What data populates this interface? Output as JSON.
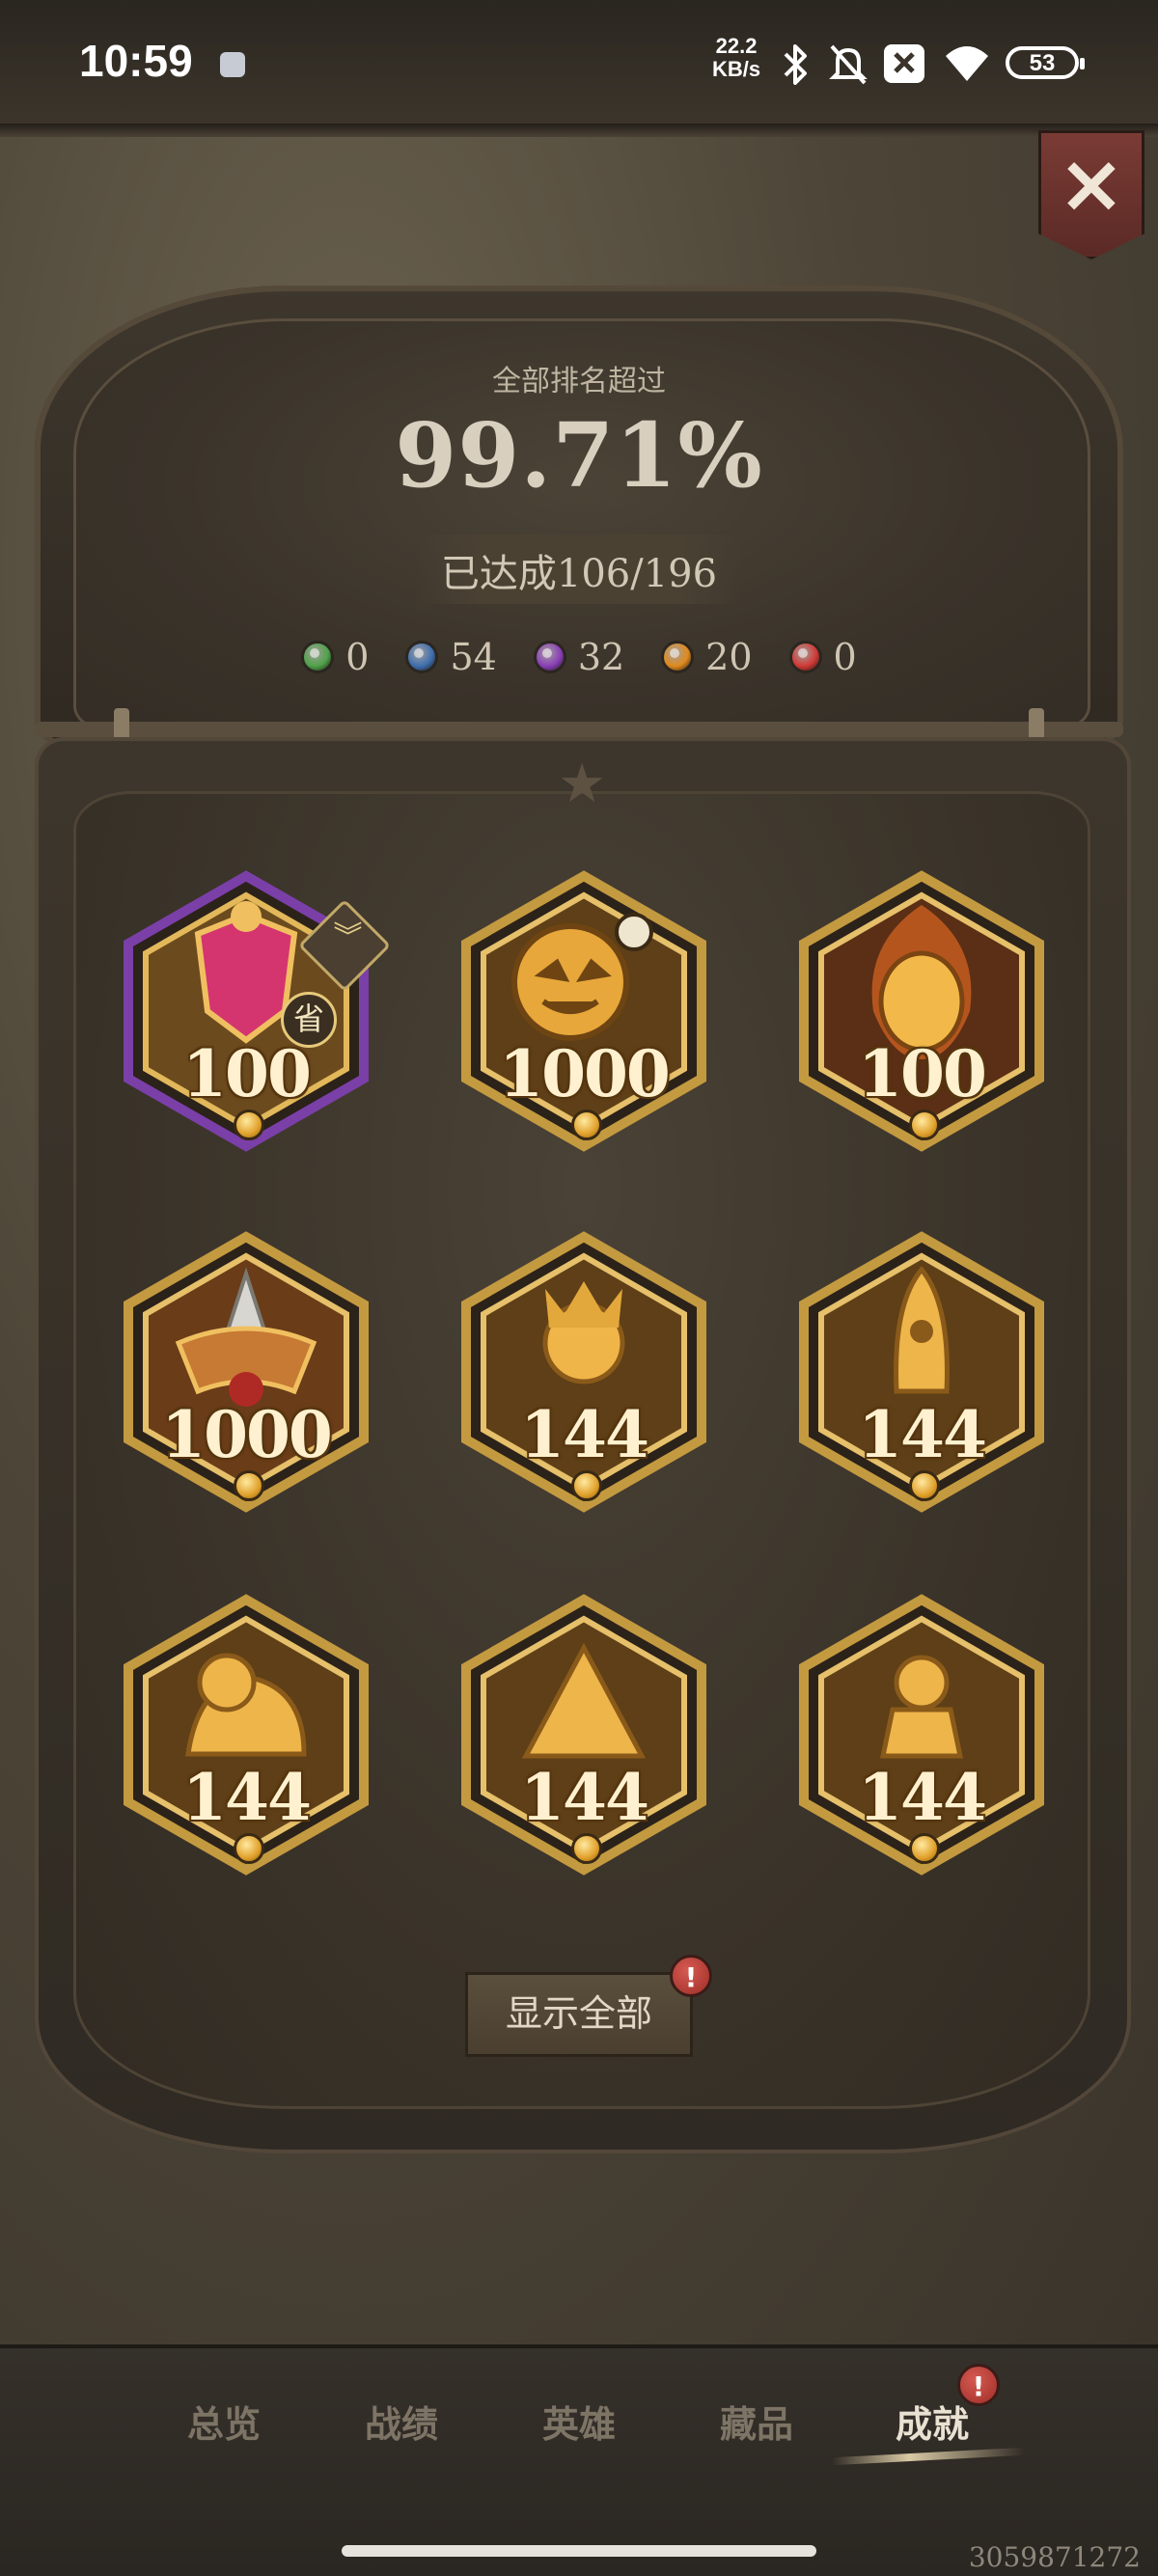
{
  "status_bar": {
    "time": "10:59",
    "speed_value": "22.2",
    "speed_unit": "KB/s",
    "battery": "53",
    "icons": [
      "app-notification-icon",
      "bluetooth-icon",
      "mute-icon",
      "close-box-icon",
      "wifi-icon",
      "battery-icon"
    ]
  },
  "header": {
    "close_icon": "×"
  },
  "summary": {
    "rank_label": "全部排名超过",
    "rank_value": "99.71%",
    "achieved": "已达成106/196",
    "gems": [
      {
        "name": "green",
        "color": "#4fa24a",
        "count": "0"
      },
      {
        "name": "blue",
        "color": "#3f6fb0",
        "count": "54"
      },
      {
        "name": "purple",
        "color": "#8a3fb8",
        "count": "32"
      },
      {
        "name": "orange",
        "color": "#e08a1e",
        "count": "20"
      },
      {
        "name": "red",
        "color": "#d23a36",
        "count": "0"
      }
    ]
  },
  "badges": [
    {
      "count": "100",
      "frame": "purple",
      "tag": "省",
      "has_chevron": true,
      "chevron": "︾"
    },
    {
      "count": "1000",
      "frame": "gold"
    },
    {
      "count": "100",
      "frame": "gold"
    },
    {
      "count": "1000",
      "frame": "gold"
    },
    {
      "count": "144",
      "frame": "gold"
    },
    {
      "count": "144",
      "frame": "gold"
    },
    {
      "count": "144",
      "frame": "gold"
    },
    {
      "count": "144",
      "frame": "gold"
    },
    {
      "count": "144",
      "frame": "gold"
    }
  ],
  "actions": {
    "show_all": "显示全部",
    "alert": "!"
  },
  "tabs": [
    {
      "label": "总览",
      "active": false
    },
    {
      "label": "战绩",
      "active": false
    },
    {
      "label": "英雄",
      "active": false
    },
    {
      "label": "藏品",
      "active": false
    },
    {
      "label": "成就",
      "active": true
    }
  ],
  "footer": {
    "uid": "3059871272"
  }
}
